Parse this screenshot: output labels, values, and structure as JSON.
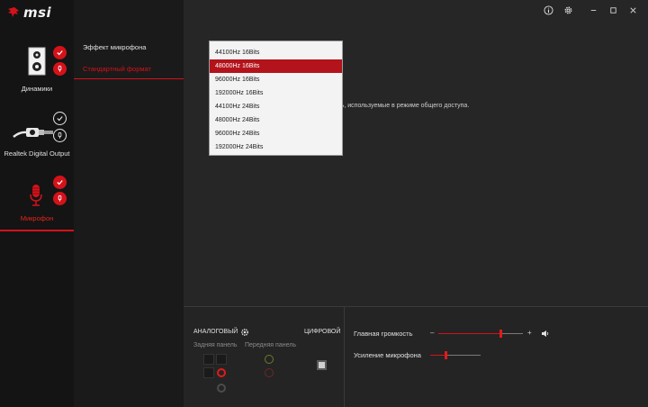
{
  "app": {
    "brand": "msi"
  },
  "window_controls": {
    "info": "info-icon",
    "settings": "gear-icon",
    "minimize": "–",
    "maximize": "□",
    "close": "✕"
  },
  "devices": [
    {
      "label": "Динамики",
      "active": false
    },
    {
      "label": "Realtek Digital Output",
      "active": false
    },
    {
      "label": "Микрофон",
      "active": true
    }
  ],
  "menu": {
    "items": [
      {
        "label": "Эффект микрофона",
        "active": false
      },
      {
        "label": "Стандартный формат",
        "active": true
      }
    ]
  },
  "main": {
    "description_visible": "сть, используемые в режиме общего доступа."
  },
  "format_dropdown": {
    "selected": "48000Hz 16Bits",
    "options": [
      "44100Hz 16Bits",
      "48000Hz 16Bits",
      "96000Hz 16Bits",
      "192000Hz 16Bits",
      "44100Hz 24Bits",
      "48000Hz 24Bits",
      "96000Hz 24Bits",
      "192000Hz 24Bits"
    ]
  },
  "jacks": {
    "analog_title": "АНАЛОГОВЫЙ",
    "digital_title": "ЦИФРОВОЙ",
    "rear_label": "Задняя панель",
    "front_label": "Передняя панель"
  },
  "volume": {
    "main_label": "Главная громкость",
    "minus": "–",
    "plus": "+",
    "main_level": 0.75,
    "mic_boost_label": "Усиление микрофона",
    "mic_boost_level": 0.2
  },
  "colors": {
    "accent": "#d4121a",
    "selected_bg": "#b3131b",
    "sidebar_bg": "#141414",
    "panel_bg": "#262626"
  }
}
